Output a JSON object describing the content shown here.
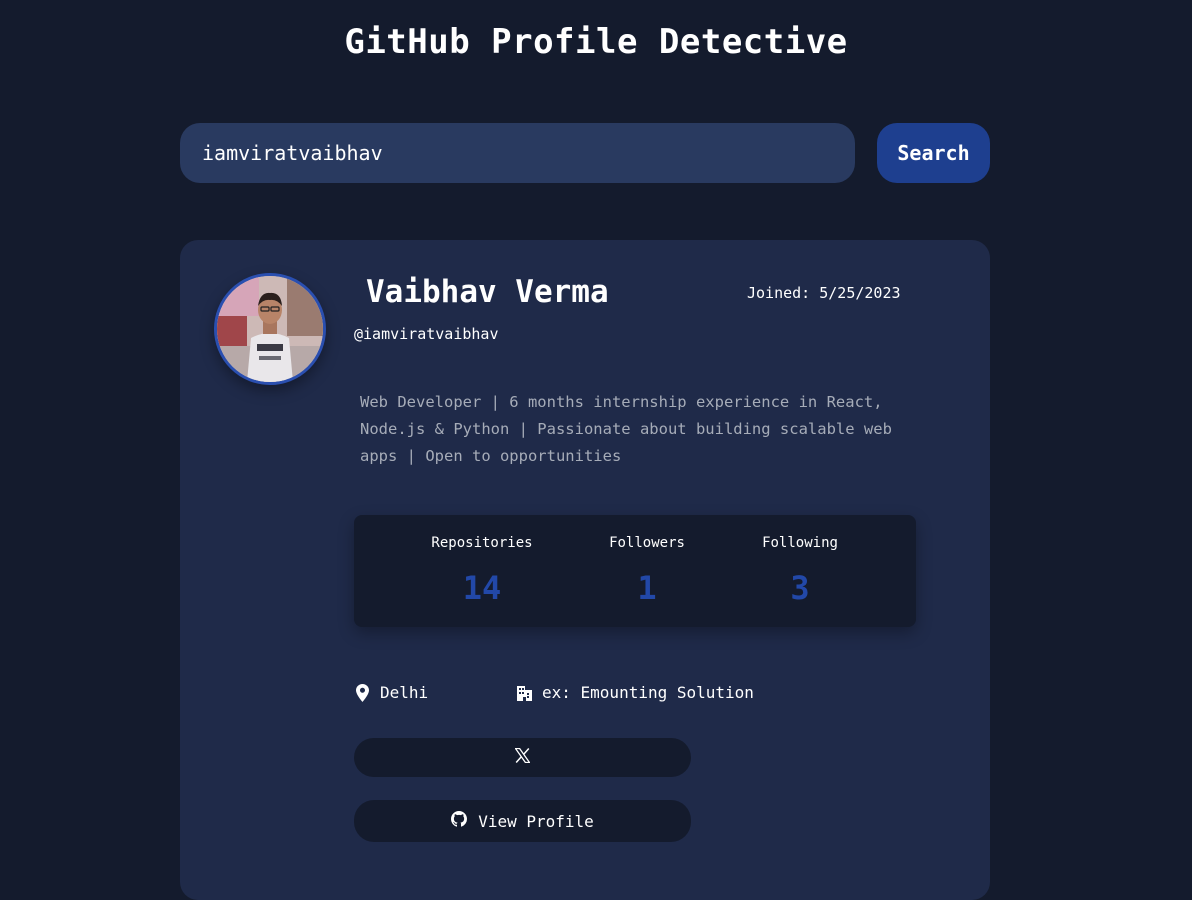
{
  "header": {
    "title": "GitHub Profile Detective"
  },
  "search": {
    "value": "iamviratvaibhav",
    "button_label": "Search"
  },
  "profile": {
    "name": "Vaibhav Verma",
    "handle": "@iamviratvaibhav",
    "joined": "Joined: 5/25/2023",
    "bio": "Web Developer | 6 months internship experience in React, Node.js & Python | Passionate about building scalable web apps | Open to opportunities",
    "stats": [
      {
        "label": "Repositories",
        "value": "14"
      },
      {
        "label": "Followers",
        "value": "1"
      },
      {
        "label": "Following",
        "value": "3"
      }
    ],
    "location": {
      "icon": "location-pin-icon",
      "text": "Delhi"
    },
    "company": {
      "icon": "building-icon",
      "text": "ex: Emounting Solution"
    },
    "links": {
      "x_icon": "x-twitter-icon",
      "view_profile_icon": "github-icon",
      "view_profile_label": "View Profile"
    }
  },
  "colors": {
    "background": "#141b2d",
    "card": "#1f2a49",
    "input": "#293a60",
    "accent": "#1e3f8f",
    "stat_value": "#2248a8",
    "bio_text": "#a6acb8"
  }
}
